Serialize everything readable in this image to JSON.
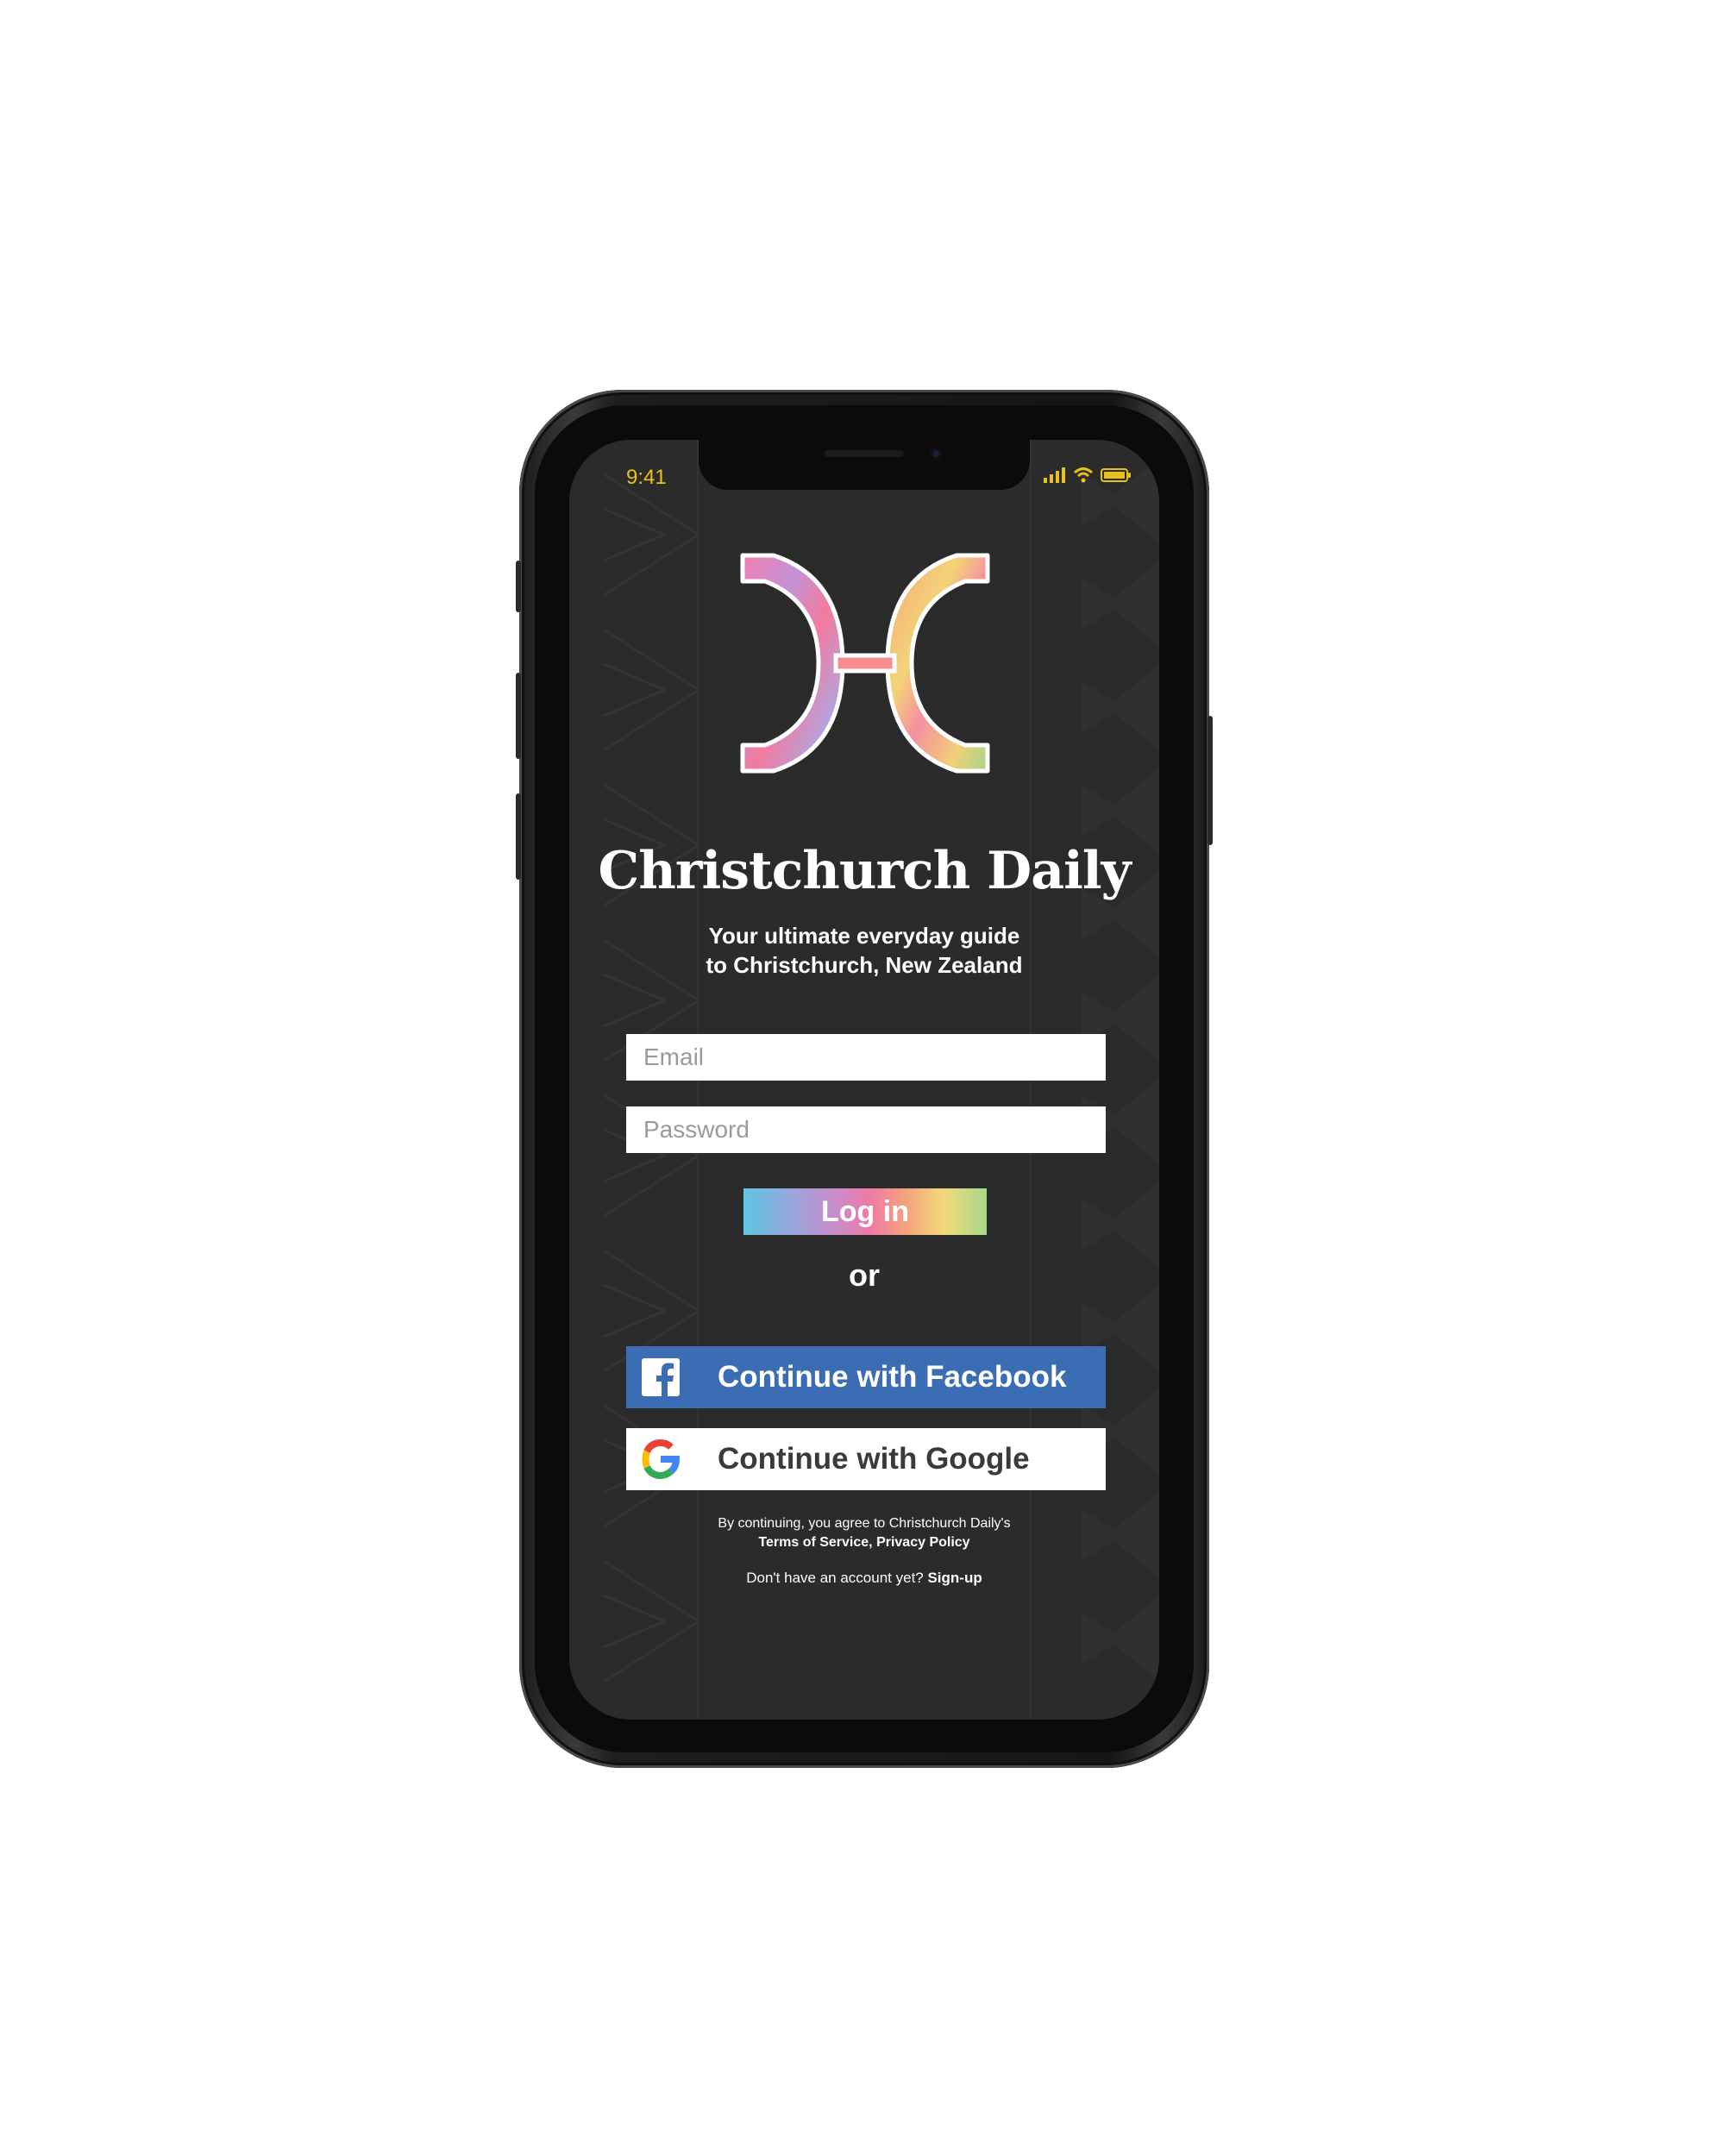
{
  "status_bar": {
    "time": "9:41",
    "icons": [
      "cellular-signal-icon",
      "wifi-icon",
      "battery-icon"
    ],
    "color": "#e8c21a"
  },
  "app": {
    "title": "Christchurch Daily",
    "tagline_line1": "Your ultimate everyday guide",
    "tagline_line2": "to Christchurch, New Zealand",
    "logo_icon": "rainbow-h-logo-icon"
  },
  "form": {
    "email_placeholder": "Email",
    "email_value": "",
    "password_placeholder": "Password",
    "password_value": "",
    "login_label": "Log in",
    "or_text": "or"
  },
  "social": {
    "facebook_label": "Continue with Facebook",
    "facebook_color": "#3b6db5",
    "google_label": "Continue with Google"
  },
  "legal": {
    "agree_text": "By continuing, you agree to Christchurch Daily's",
    "terms_link": "Terms of Service",
    "separator": ", ",
    "privacy_link": "Privacy Policy",
    "no_account_text": "Don't have an account yet? ",
    "signup_link": "Sign-up"
  },
  "colors": {
    "screen_bg": "#2b2b2b",
    "gradient": [
      "#5ec6e2",
      "#c98cc8",
      "#ee7aa6",
      "#f3a07e",
      "#f4d77a",
      "#a8d98a"
    ]
  }
}
